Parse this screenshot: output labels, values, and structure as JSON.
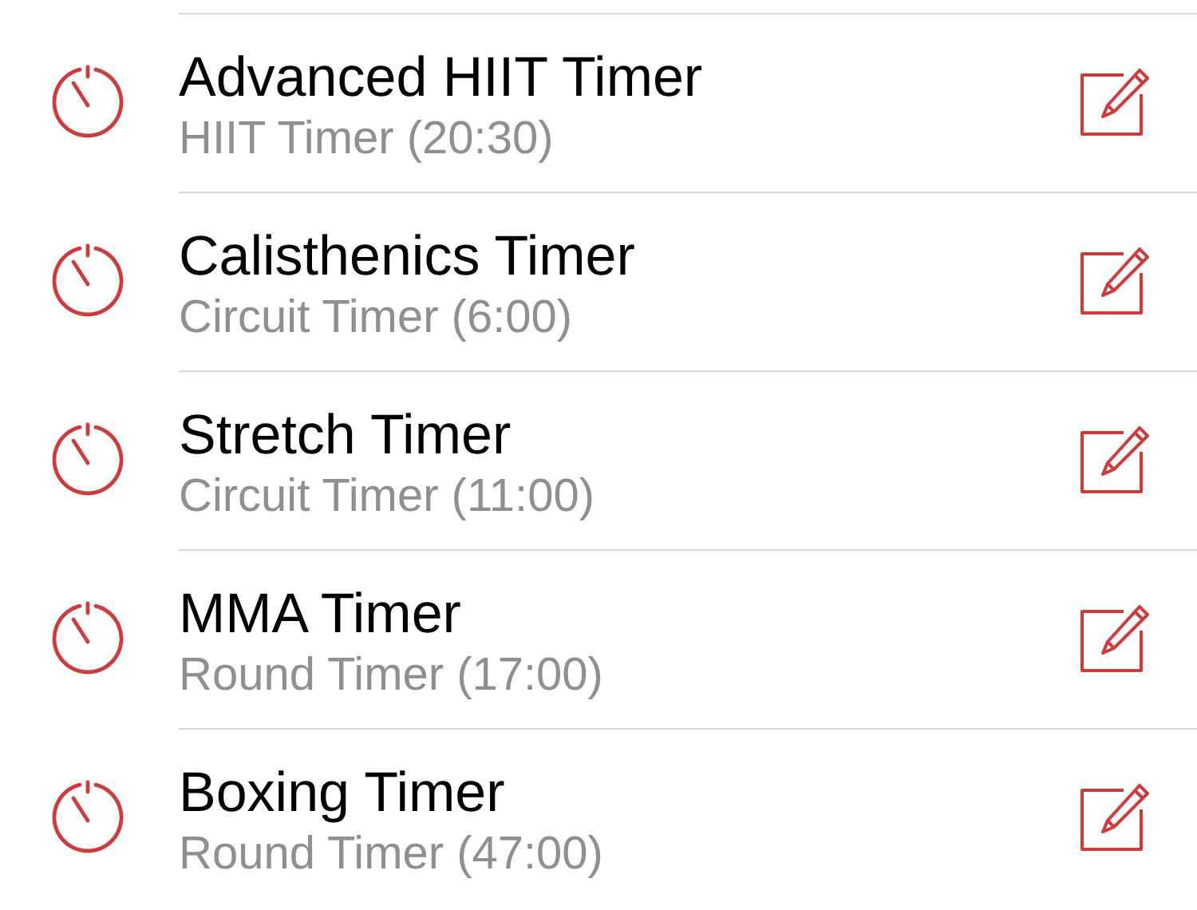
{
  "timers": [
    {
      "title": "Advanced HIIT Timer",
      "subtitle": "HIIT Timer (20:30)"
    },
    {
      "title": "Calisthenics Timer",
      "subtitle": "Circuit Timer (6:00)"
    },
    {
      "title": "Stretch Timer",
      "subtitle": "Circuit Timer (11:00)"
    },
    {
      "title": "MMA Timer",
      "subtitle": "Round Timer (17:00)"
    },
    {
      "title": "Boxing Timer",
      "subtitle": "Round Timer (47:00)"
    }
  ]
}
